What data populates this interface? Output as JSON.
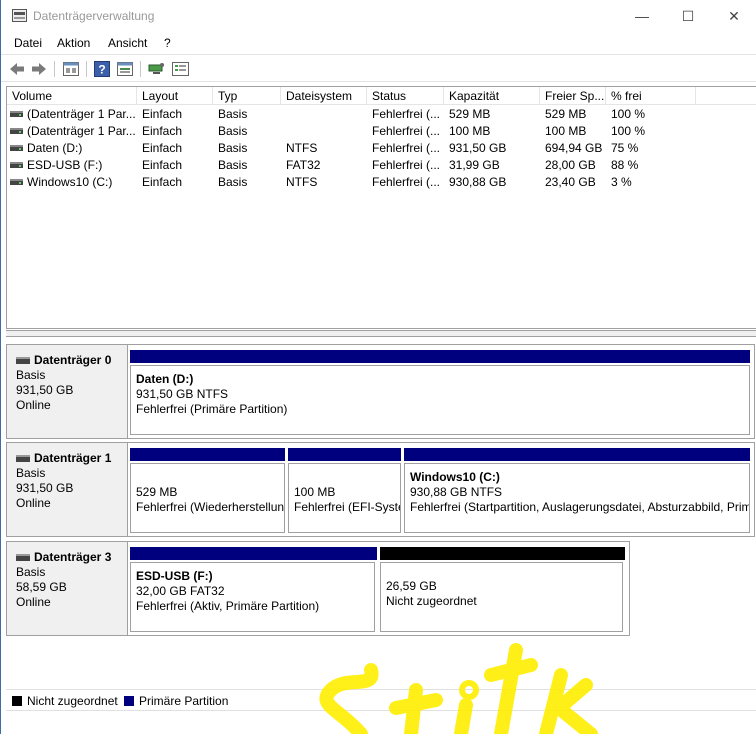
{
  "window": {
    "title": "Datenträgerverwaltung",
    "controls": [
      "—",
      "☐",
      "✕"
    ]
  },
  "menu": [
    "Datei",
    "Aktion",
    "Ansicht",
    "?"
  ],
  "toolbar_icons": [
    "back-arrow-icon",
    "forward-arrow-icon",
    "properties-icon",
    "help-icon",
    "console-view-icon",
    "disk-connect-icon",
    "settings-list-icon"
  ],
  "volume_list": {
    "columns": [
      "Volume",
      "Layout",
      "Typ",
      "Dateisystem",
      "Status",
      "Kapazität",
      "Freier Sp...",
      "% frei"
    ],
    "rows": [
      [
        "(Datenträger 1 Par...",
        "Einfach",
        "Basis",
        "",
        "Fehlerfrei (...",
        "529 MB",
        "529 MB",
        "100 %"
      ],
      [
        "(Datenträger 1 Par...",
        "Einfach",
        "Basis",
        "",
        "Fehlerfrei (...",
        "100 MB",
        "100 MB",
        "100 %"
      ],
      [
        "Daten (D:)",
        "Einfach",
        "Basis",
        "NTFS",
        "Fehlerfrei (...",
        "931,50 GB",
        "694,94 GB",
        "75 %"
      ],
      [
        "ESD-USB (F:)",
        "Einfach",
        "Basis",
        "FAT32",
        "Fehlerfrei (...",
        "31,99 GB",
        "28,00 GB",
        "88 %"
      ],
      [
        "Windows10 (C:)",
        "Einfach",
        "Basis",
        "NTFS",
        "Fehlerfrei (...",
        "930,88 GB",
        "23,40 GB",
        "3 %"
      ]
    ]
  },
  "disks": [
    {
      "name": "Datenträger 0",
      "type": "Basis",
      "size": "931,50 GB",
      "state": "Online",
      "partitions": [
        {
          "name": "Daten  (D:)",
          "size": "931,50 GB NTFS",
          "status": "Fehlerfrei (Primäre Partition)",
          "kind": "primary"
        }
      ]
    },
    {
      "name": "Datenträger 1",
      "type": "Basis",
      "size": "931,50 GB",
      "state": "Online",
      "partitions": [
        {
          "name": "",
          "size": "529 MB",
          "status": "Fehlerfrei (Wiederherstellungspartition)",
          "kind": "primary"
        },
        {
          "name": "",
          "size": "100 MB",
          "status": "Fehlerfrei (EFI-Systempartition)",
          "kind": "primary"
        },
        {
          "name": "Windows10  (C:)",
          "size": "930,88 GB NTFS",
          "status": "Fehlerfrei (Startpartition, Auslagerungsdatei, Absturzabbild, Primäre Partition)",
          "kind": "primary"
        }
      ]
    },
    {
      "name": "Datenträger 3",
      "type": "Basis",
      "size": "58,59 GB",
      "state": "Online",
      "partitions": [
        {
          "name": "ESD-USB  (F:)",
          "size": "32,00 GB FAT32",
          "status": "Fehlerfrei (Aktiv, Primäre Partition)",
          "kind": "primary"
        },
        {
          "name": "",
          "size": "26,59 GB",
          "status": "Nicht zugeordnet",
          "kind": "unallocated"
        }
      ]
    }
  ],
  "legend": [
    {
      "label": "Nicht zugeordnet",
      "color": "#000000"
    },
    {
      "label": "Primäre Partition",
      "color": "#00007f"
    }
  ],
  "colors": {
    "primary_bar": "#00007f",
    "unallocated_bar": "#000000",
    "watermark": "#ffee00"
  }
}
